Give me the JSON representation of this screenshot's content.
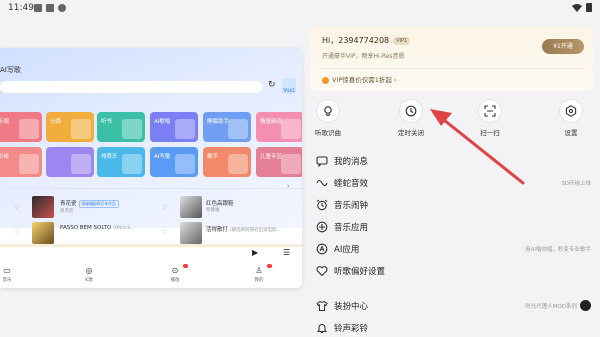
{
  "status_bar": {
    "time": "11:49"
  },
  "background_app": {
    "title": "AI写歌",
    "badge": "TALK1",
    "cards_row1": [
      "乐唱",
      "分类",
      "听书",
      "AI歌唱",
      "睡眠助手",
      "情感频道"
    ],
    "cards_row2": [
      "乐绘",
      "",
      "排首乐",
      "AI写歌",
      "歌手",
      "儿童专区"
    ],
    "songs": [
      {
        "title": "青花瓷",
        "tag": "限量编配网日本作品",
        "artist": "周杰伦"
      },
      {
        "title": "红色高跟鞋",
        "tag": "",
        "artist": "蔡健雅"
      },
      {
        "title": "PASSO BEM SOLTO",
        "tag": "(Ultra S...",
        "artist": ""
      },
      {
        "title": "活得散打",
        "tag": "(摘选将阿那的出道电影...",
        "artist": ""
      }
    ],
    "nav": [
      "音乐",
      "K歌",
      "播放",
      "我的"
    ]
  },
  "drawer": {
    "vip": {
      "greeting": "Hi，2394774208",
      "level_badge": "VIP1",
      "subtitle": "开通豪华VIP，畅享Hi-Res音质",
      "open_button": "¥1开通",
      "deal": "VIP惊喜价仅需1折起"
    },
    "quick_actions": [
      {
        "label": "听歌识曲",
        "icon": "mic-listen-icon"
      },
      {
        "label": "定时关闭",
        "icon": "clock-icon"
      },
      {
        "label": "扫一扫",
        "icon": "scan-icon"
      },
      {
        "label": "设置",
        "icon": "settings-hexagon-icon"
      }
    ],
    "menu": [
      {
        "label": "我的消息",
        "right": "",
        "icon": "message-icon"
      },
      {
        "label": "蝰蛇音效",
        "right": "3D环绕上线",
        "icon": "sound-effect-icon"
      },
      {
        "label": "音乐闹钟",
        "right": "",
        "icon": "alarm-icon"
      },
      {
        "label": "音乐应用",
        "right": "",
        "icon": "app-icon"
      },
      {
        "label": "AI应用",
        "right": "用AI唱你唱，秒变专业歌手",
        "icon": "ai-app-icon"
      },
      {
        "label": "听歌偏好设置",
        "right": "",
        "icon": "heart-preference-icon"
      },
      {
        "label": "装扮中心",
        "right": "时光代理人MOD系列",
        "icon": "shirt-icon"
      },
      {
        "label": "铃声彩铃",
        "right": "",
        "icon": "bell-icon"
      }
    ]
  },
  "colors": {
    "accent_gold": "#9a7b52",
    "arrow_red": "#e04343"
  }
}
